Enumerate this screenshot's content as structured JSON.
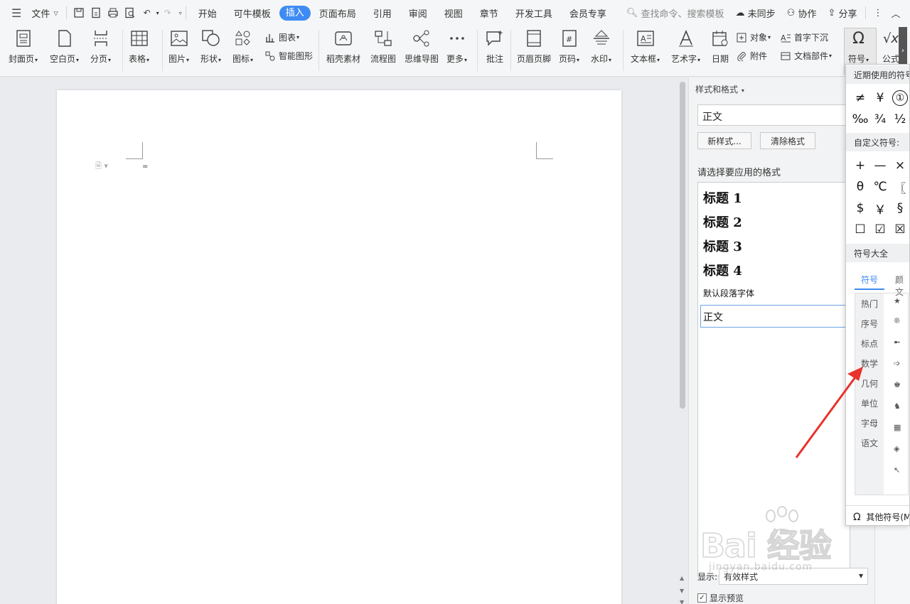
{
  "menubar": {
    "file_label": "文件",
    "tabs": [
      "开始",
      "可牛模板",
      "插入",
      "页面布局",
      "引用",
      "审阅",
      "视图",
      "章节",
      "开发工具",
      "会员专享"
    ],
    "active_tab": "插入",
    "search_placeholder": "查找命令、搜索模板",
    "sync_label": "未同步",
    "collab_label": "协作",
    "share_label": "分享"
  },
  "ribbon": {
    "cover_page": "封面页",
    "blank_page": "空白页",
    "page_break": "分页",
    "table": "表格",
    "picture": "图片",
    "shape": "形状",
    "icon": "图标",
    "chart": "图表",
    "smart_art": "智能图形",
    "docer_material": "稻壳素材",
    "flowchart": "流程图",
    "mindmap": "思维导图",
    "more": "更多",
    "comment": "批注",
    "header_footer": "页眉页脚",
    "page_number": "页码",
    "watermark": "水印",
    "textbox": "文本框",
    "wordart": "艺术字",
    "date": "日期",
    "object": "对象",
    "attachment": "附件",
    "drop_cap": "首字下沉",
    "doc_parts": "文档部件",
    "symbol": "符号",
    "formula": "公式"
  },
  "document": {
    "paragraph_mark": "="
  },
  "styles_panel": {
    "title": "样式和格式",
    "current_style": "正文",
    "new_style_btn": "新样式...",
    "clear_format_btn": "清除格式",
    "choose_label": "请选择要应用的格式",
    "headings": [
      "标题 1",
      "标题 2",
      "标题 3",
      "标题 4"
    ],
    "default_font": "默认段落字体",
    "selected_style": "正文",
    "show_label": "显示:",
    "show_value": "有效样式",
    "preview_label": "显示预览"
  },
  "symbol_dropdown": {
    "recent_header": "近期使用的符号",
    "recent": [
      "≠",
      "¥",
      "①",
      "‰",
      "¾",
      "½"
    ],
    "custom_header": "自定义符号:",
    "custom": [
      "+",
      "—",
      "×",
      "θ",
      "℃",
      "〖",
      "$",
      "￥",
      "§",
      "☐",
      "☑",
      "☒"
    ],
    "all_header": "符号大全",
    "tabs": [
      "符号",
      "颜文"
    ],
    "categories": [
      "热门",
      "序号",
      "标点",
      "数学",
      "几何",
      "单位",
      "字母",
      "语文"
    ],
    "glyphs": [
      "★",
      "❊",
      "➼",
      "➩",
      "♚",
      "♞",
      "▦",
      "◈",
      "↖"
    ],
    "footer": "其他符号(M)..."
  },
  "watermark": {
    "brand": "Bai  经验",
    "url": "jingyan.baidu.com"
  },
  "colors": {
    "accent": "#3e8bf3",
    "arrow": "#e8322b"
  }
}
